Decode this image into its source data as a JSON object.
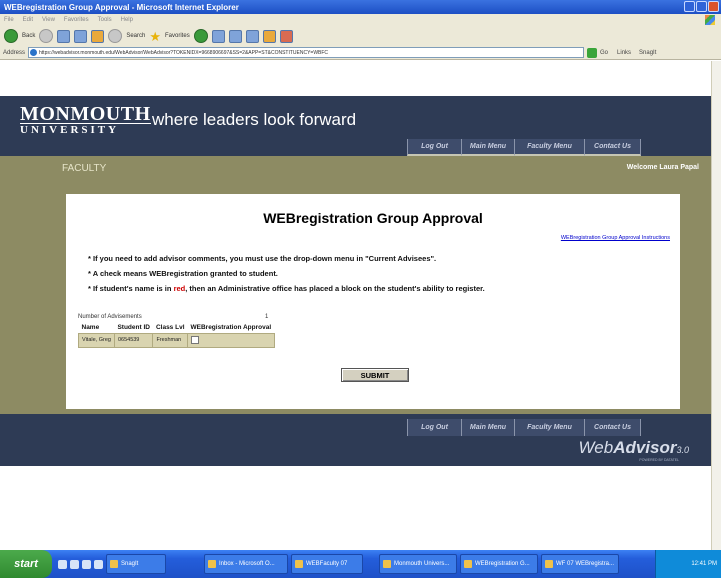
{
  "window": {
    "title": "WEBregistration Group Approval - Microsoft Internet Explorer"
  },
  "browser": {
    "menu": [
      "File",
      "Edit",
      "View",
      "Favorites",
      "Tools",
      "Help"
    ],
    "toolbar": {
      "back": "Back",
      "search": "Search",
      "favorites": "Favorites"
    },
    "address_label": "Address",
    "url": "https://webadvisor.monmouth.edu/WebAdvisor/WebAdvisor?TOKENIDX=9668906697&SS=2&APP=ST&CONSTITUENCY=WBFC",
    "go_label": "Go",
    "links_label": "Links",
    "snagit_label": "SnagIt"
  },
  "header": {
    "logo_line1": "MONMOUTH",
    "logo_line2": "UNIVERSITY",
    "tagline": "where leaders look forward"
  },
  "nav": {
    "logout": "Log Out",
    "main_menu": "Main Menu",
    "faculty_menu": "Faculty Menu",
    "contact_us": "Contact Us"
  },
  "band": {
    "section": "FACULTY",
    "welcome": "Welcome Laura Papal"
  },
  "main": {
    "title": "WEBregistration Group Approval",
    "instructions_link": "WEBregistration Group Approval Instructions",
    "bullet1": "* If you need to add advisor comments, you must use the drop-down menu in \"Current Advisees\".",
    "bullet2": "* A check means WEBregistration granted to student.",
    "bullet3_pre": "* If student's name is in ",
    "bullet3_red": "red",
    "bullet3_post": ", then an Administrative office has placed a block on the student's ability to register.",
    "num_advisements_label": "Number of Advisements",
    "num_advisements_value": "1",
    "table": {
      "headers": [
        "Name",
        "Student ID",
        "Class Lvl",
        "WEBregistration Approval"
      ],
      "rows": [
        {
          "name": "Vitale, Greg",
          "student_id": "0654539",
          "class_lvl": "Freshman",
          "approved": false
        }
      ]
    },
    "submit_label": "SUBMIT"
  },
  "footer": {
    "brand_web": "Web",
    "brand_advisor": "Advisor",
    "brand_version": "3.0",
    "brand_sub": "POWERED BY DATATEL"
  },
  "taskbar": {
    "start": "start",
    "tasks": [
      "SnagIt",
      "Inbox - Microsoft O...",
      "WEBFaculty 07",
      "Monmouth Univers...",
      "WEBregistration G...",
      "WF 07 WEBregistra..."
    ],
    "clock": "12:41 PM"
  }
}
